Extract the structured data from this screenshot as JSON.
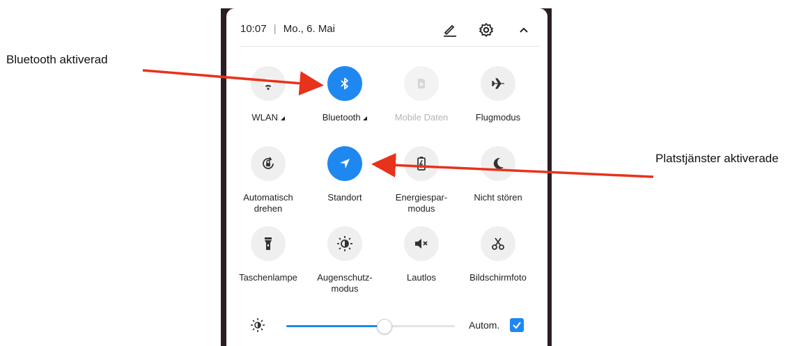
{
  "annotations": {
    "left_label": "Bluetooth aktiverad",
    "right_label": "Platstjänster aktiverade",
    "arrow_color": "#e8321c"
  },
  "header": {
    "time": "10:07",
    "separator": "|",
    "date": "Mo., 6. Mai",
    "icons": [
      "edit-icon",
      "gear-icon",
      "chevron-up-icon"
    ]
  },
  "tiles": [
    {
      "name": "wlan",
      "label": "WLAN",
      "dropdown": true,
      "icon": "wifi-icon",
      "active": false,
      "disabled": false
    },
    {
      "name": "bluetooth",
      "label": "Bluetooth",
      "dropdown": true,
      "icon": "bluetooth-icon",
      "active": true,
      "disabled": false
    },
    {
      "name": "mobile-data",
      "label": "Mobile Daten",
      "dropdown": false,
      "icon": "sim-icon",
      "active": false,
      "disabled": true
    },
    {
      "name": "airplane",
      "label": "Flugmodus",
      "dropdown": false,
      "icon": "airplane-icon",
      "active": false,
      "disabled": false
    },
    {
      "name": "auto-rotate",
      "label": "Automatisch\ndrehen",
      "dropdown": false,
      "icon": "rotate-lock-icon",
      "active": false,
      "disabled": false
    },
    {
      "name": "location",
      "label": "Standort",
      "dropdown": false,
      "icon": "location-arrow-icon",
      "active": true,
      "disabled": false
    },
    {
      "name": "battery-saver",
      "label": "Energiespar-\nmodus",
      "dropdown": false,
      "icon": "battery-icon",
      "active": false,
      "disabled": false
    },
    {
      "name": "do-not-disturb",
      "label": "Nicht stören",
      "dropdown": false,
      "icon": "moon-icon",
      "active": false,
      "disabled": false
    },
    {
      "name": "flashlight",
      "label": "Taschenlampe",
      "dropdown": false,
      "icon": "flashlight-icon",
      "active": false,
      "disabled": false
    },
    {
      "name": "eye-comfort",
      "label": "Augenschutz-\nmodus",
      "dropdown": false,
      "icon": "eye-comfort-icon",
      "active": false,
      "disabled": false
    },
    {
      "name": "silent",
      "label": "Lautlos",
      "dropdown": false,
      "icon": "mute-icon",
      "active": false,
      "disabled": false
    },
    {
      "name": "screenshot",
      "label": "Bildschirmfoto",
      "dropdown": false,
      "icon": "scissors-icon",
      "active": false,
      "disabled": false
    }
  ],
  "brightness": {
    "level": 0.58,
    "auto_label": "Autom.",
    "auto_checked": true,
    "icon": "brightness-icon"
  },
  "colors": {
    "accent": "#1e88f0",
    "inactive_tile": "#efefef",
    "disabled_text": "#b5b5b5"
  }
}
